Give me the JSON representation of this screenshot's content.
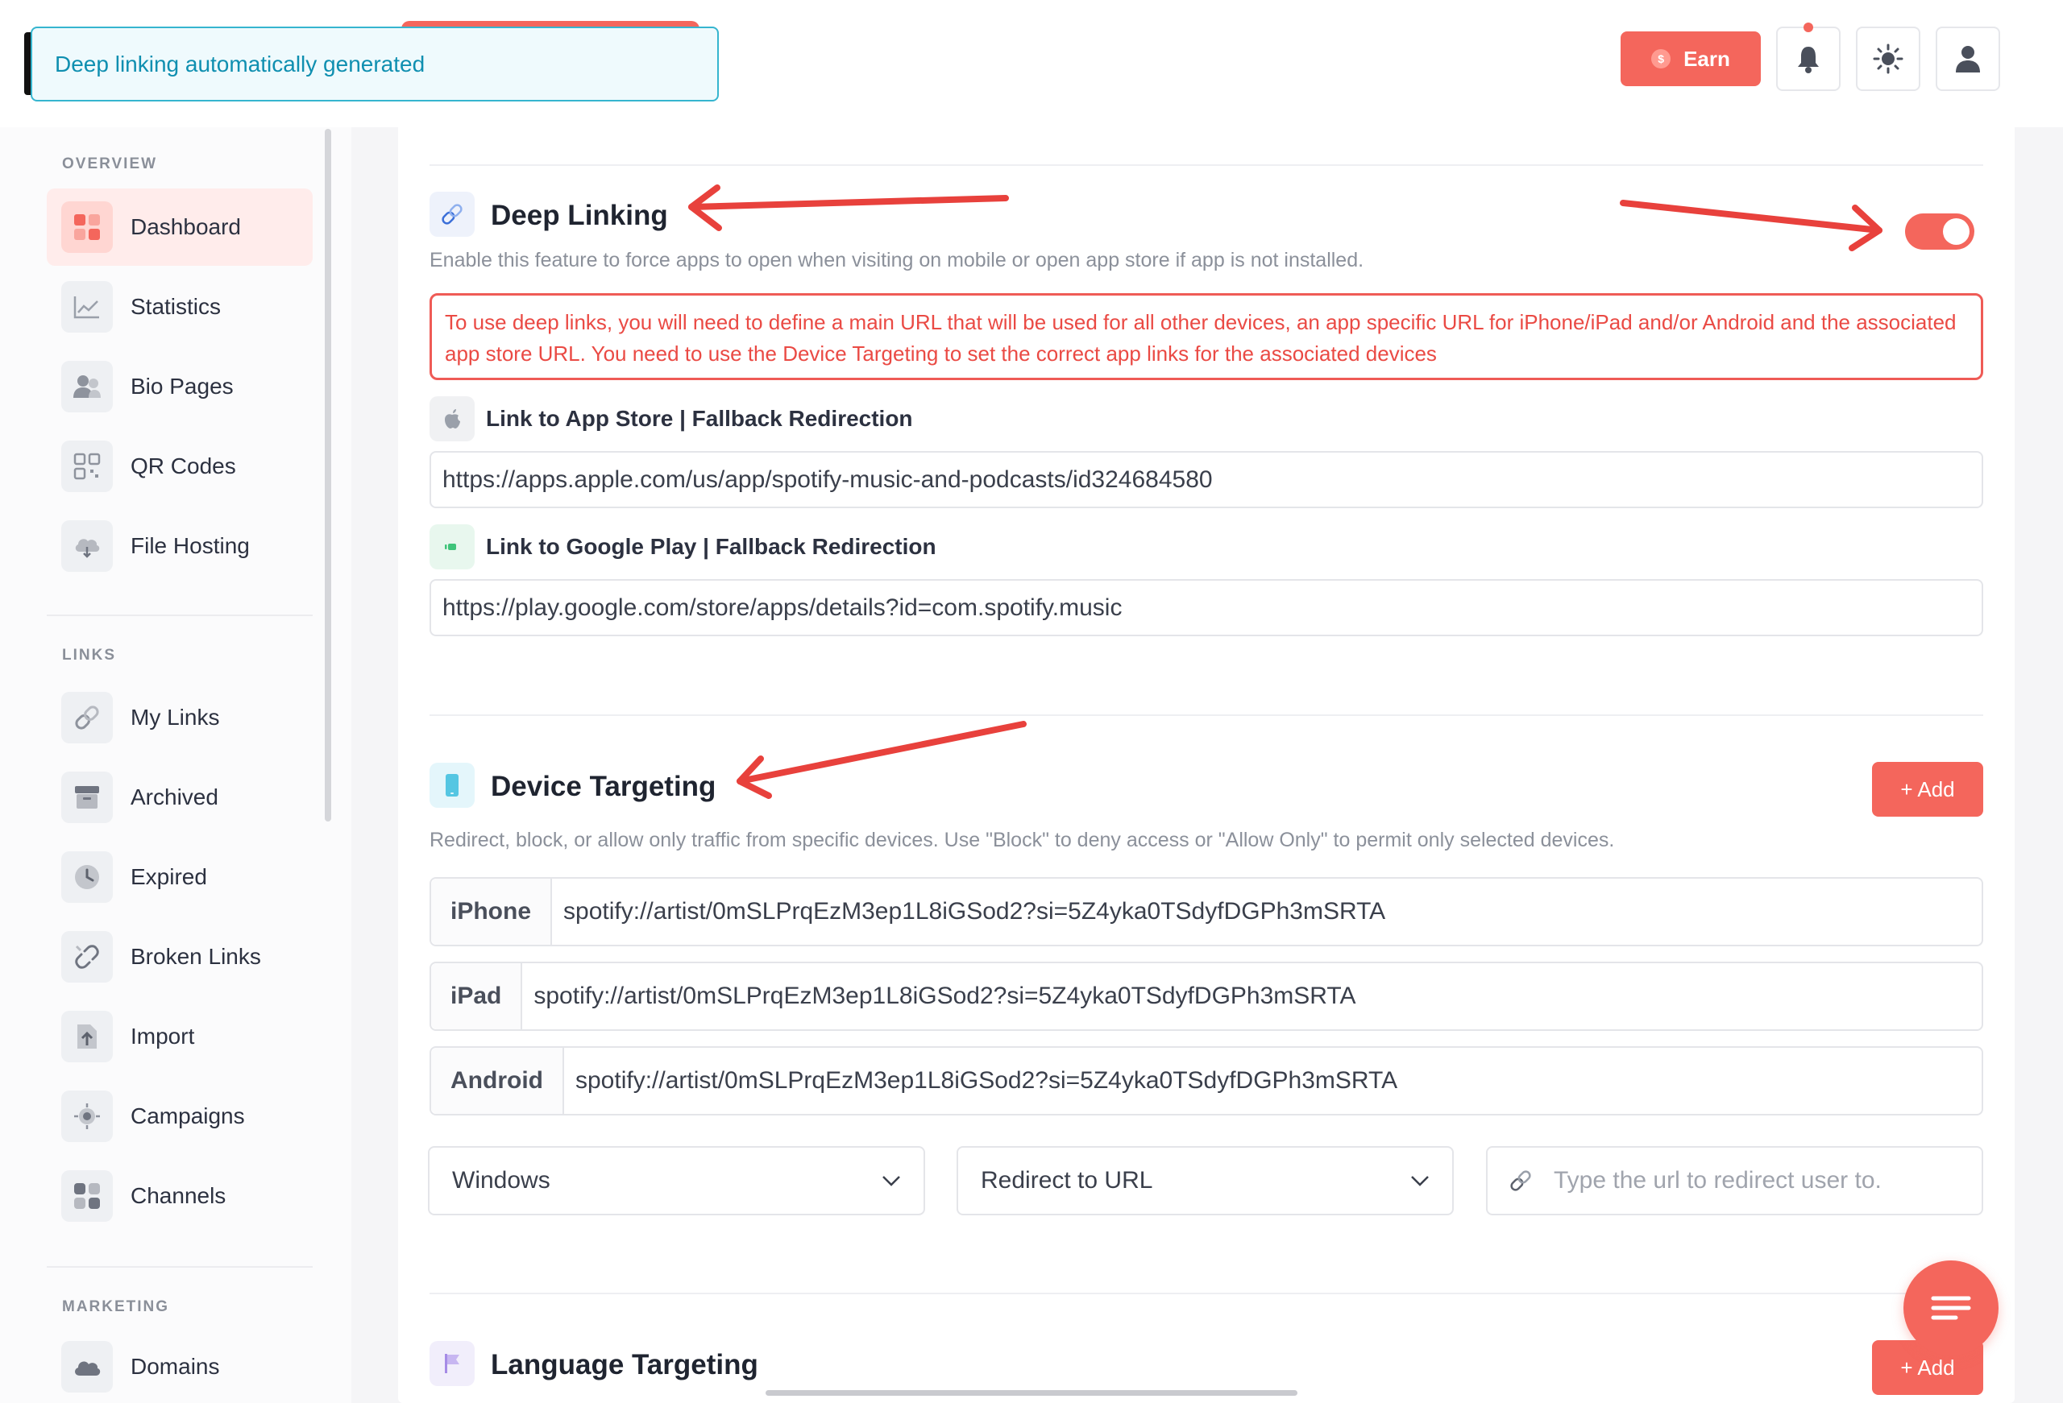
{
  "toast": {
    "message": "Deep linking automatically generated"
  },
  "header": {
    "earn_label": "Earn",
    "earn_coin": "$"
  },
  "sidebar": {
    "sections": [
      {
        "title": "OVERVIEW",
        "items": [
          {
            "label": "Dashboard",
            "icon": "dashboard-icon",
            "active": true
          },
          {
            "label": "Statistics",
            "icon": "statistics-icon"
          },
          {
            "label": "Bio Pages",
            "icon": "bio-pages-icon"
          },
          {
            "label": "QR Codes",
            "icon": "qr-code-icon"
          },
          {
            "label": "File Hosting",
            "icon": "cloud-icon"
          }
        ]
      },
      {
        "title": "LINKS",
        "items": [
          {
            "label": "My Links",
            "icon": "link-icon"
          },
          {
            "label": "Archived",
            "icon": "archive-icon"
          },
          {
            "label": "Expired",
            "icon": "clock-icon"
          },
          {
            "label": "Broken Links",
            "icon": "broken-link-icon"
          },
          {
            "label": "Import",
            "icon": "import-icon"
          },
          {
            "label": "Campaigns",
            "icon": "target-icon"
          },
          {
            "label": "Channels",
            "icon": "channels-icon"
          }
        ]
      },
      {
        "title": "MARKETING",
        "items": [
          {
            "label": "Domains",
            "icon": "cloud-domain-icon"
          }
        ]
      }
    ]
  },
  "deep_linking": {
    "title": "Deep Linking",
    "description": "Enable this feature to force apps to open when visiting on mobile or open app store if app is not installed.",
    "enabled": true,
    "alert": "To use deep links, you will need to define a main URL that will be used for all other devices, an app specific URL for iPhone/iPad and/or Android and the associated app store URL. You need to use the Device Targeting to set the correct app links for the associated devices",
    "app_store_label": "Link to App Store | Fallback Redirection",
    "app_store_url": "https://apps.apple.com/us/app/spotify-music-and-podcasts/id324684580",
    "google_play_label": "Link to Google Play | Fallback Redirection",
    "google_play_url": "https://play.google.com/store/apps/details?id=com.spotify.music"
  },
  "device_targeting": {
    "title": "Device Targeting",
    "add_label": "+ Add",
    "description": "Redirect, block, or allow only traffic from specific devices. Use \"Block\" to deny access or \"Allow Only\" to permit only selected devices.",
    "rows": [
      {
        "device": "iPhone",
        "value": "spotify://artist/0mSLPrqEzM3ep1L8iGSod2?si=5Z4yka0TSdyfDGPh3mSRTA"
      },
      {
        "device": "iPad",
        "value": "spotify://artist/0mSLPrqEzM3ep1L8iGSod2?si=5Z4yka0TSdyfDGPh3mSRTA"
      },
      {
        "device": "Android",
        "value": "spotify://artist/0mSLPrqEzM3ep1L8iGSod2?si=5Z4yka0TSdyfDGPh3mSRTA"
      }
    ],
    "new_row": {
      "device_select": "Windows",
      "action_select": "Redirect to URL",
      "url_placeholder": "Type the url to redirect user to."
    }
  },
  "language_targeting": {
    "title": "Language Targeting",
    "add_label": "+ Add"
  },
  "colors": {
    "accent": "#f4665c",
    "toast_border": "#36b5cf",
    "alert_red": "#ea4a44"
  }
}
